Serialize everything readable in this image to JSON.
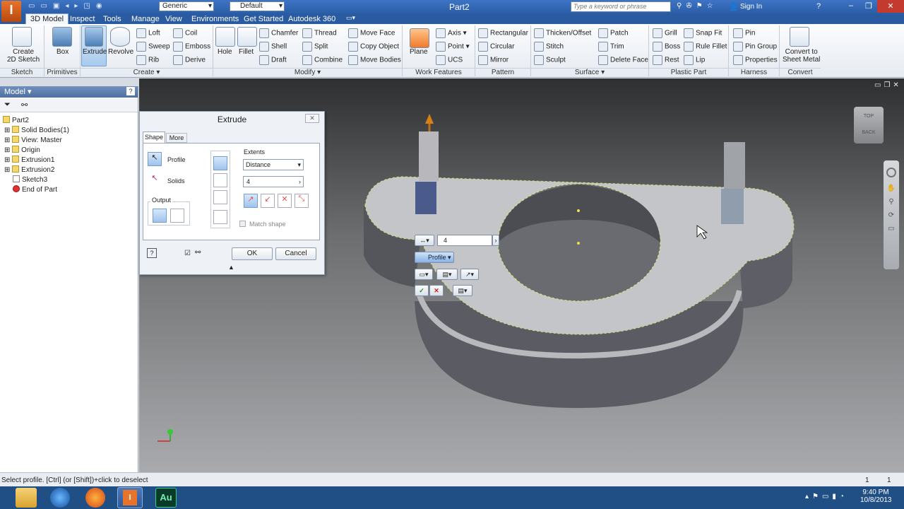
{
  "app": {
    "logo": "I",
    "doc_title": "Part2",
    "appearance": "Generic",
    "display_style": "Default",
    "search_placeholder": "Type a keyword or phrase",
    "sign_in": "Sign In"
  },
  "menu": [
    "3D Model",
    "Inspect",
    "Tools",
    "Manage",
    "View",
    "Environments",
    "Get Started",
    "Autodesk 360"
  ],
  "ribbon": {
    "sketch": {
      "create_sketch": "Create\n2D Sketch",
      "group": "Sketch"
    },
    "primitives": {
      "box": "Box",
      "group": "Primitives"
    },
    "create": {
      "extrude": "Extrude",
      "revolve": "Revolve",
      "loft": "Loft",
      "sweep": "Sweep",
      "rib": "Rib",
      "coil": "Coil",
      "emboss": "Emboss",
      "derive": "Derive",
      "group": "Create"
    },
    "modify": {
      "hole": "Hole",
      "fillet": "Fillet",
      "chamfer": "Chamfer",
      "shell": "Shell",
      "draft": "Draft",
      "thread": "Thread",
      "split": "Split",
      "combine": "Combine",
      "move_face": "Move Face",
      "copy_object": "Copy Object",
      "move_bodies": "Move Bodies",
      "group": "Modify"
    },
    "work": {
      "plane": "Plane",
      "axis": "Axis",
      "point": "Point",
      "ucs": "UCS",
      "group": "Work Features"
    },
    "pattern": {
      "rectangular": "Rectangular",
      "circular": "Circular",
      "mirror": "Mirror",
      "group": "Pattern"
    },
    "surface": {
      "thicken": "Thicken/Offset",
      "stitch": "Stitch",
      "sculpt": "Sculpt",
      "patch": "Patch",
      "trim": "Trim",
      "delete_face": "Delete Face",
      "group": "Surface"
    },
    "plastic": {
      "grill": "Grill",
      "boss": "Boss",
      "rest": "Rest",
      "snap_fit": "Snap Fit",
      "rule_fillet": "Rule Fillet",
      "lip": "Lip",
      "group": "Plastic Part"
    },
    "harness": {
      "pin": "Pin",
      "pin_group": "Pin Group",
      "properties": "Properties",
      "group": "Harness"
    },
    "convert": {
      "convert": "Convert to\nSheet Metal",
      "group": "Convert"
    }
  },
  "browser": {
    "title": "Model",
    "items": [
      "Part2",
      "Solid Bodies(1)",
      "View: Master",
      "Origin",
      "Extrusion1",
      "Extrusion2",
      "Sketch3",
      "End of Part"
    ]
  },
  "dialog": {
    "title": "Extrude",
    "tab_shape": "Shape",
    "tab_more": "More",
    "profile": "Profile",
    "solids": "Solids",
    "output": "Output",
    "extents": "Extents",
    "extent_type": "Distance",
    "distance": "4",
    "match_shape": "Match shape",
    "ok": "OK",
    "cancel": "Cancel"
  },
  "minitoolbar": {
    "distance": "4",
    "profile": "Profile"
  },
  "viewcube": {
    "top": "TOP",
    "back": "BACK"
  },
  "status": {
    "text": "Select profile. [Ctrl] (or [Shift])+click to deselect",
    "n1": "1",
    "n2": "1"
  },
  "taskbar": {
    "time": "9:40 PM",
    "date": "10/8/2013",
    "au": "Au"
  }
}
